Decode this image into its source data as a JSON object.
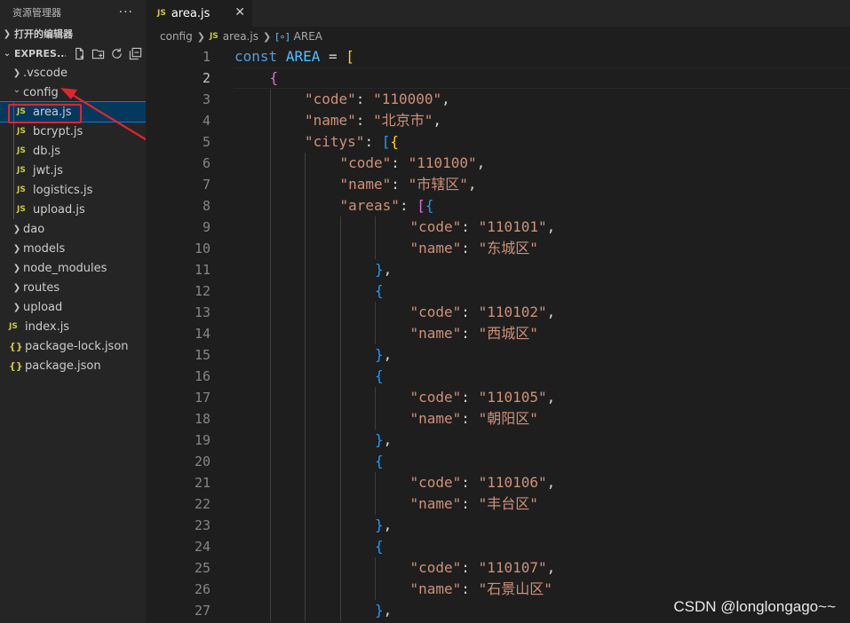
{
  "sidebar": {
    "title": "资源管理器",
    "more": "···",
    "open_editors": "打开的编辑器",
    "project": "EXPRES...",
    "tree": [
      {
        "name": ".vscode",
        "kind": "folder",
        "expanded": false
      },
      {
        "name": "config",
        "kind": "folder",
        "expanded": true
      },
      {
        "name": "area.js",
        "kind": "js",
        "selected": true
      },
      {
        "name": "bcrypt.js",
        "kind": "js"
      },
      {
        "name": "db.js",
        "kind": "js"
      },
      {
        "name": "jwt.js",
        "kind": "js"
      },
      {
        "name": "logistics.js",
        "kind": "js"
      },
      {
        "name": "upload.js",
        "kind": "js"
      },
      {
        "name": "dao",
        "kind": "folder",
        "expanded": false
      },
      {
        "name": "models",
        "kind": "folder",
        "expanded": false
      },
      {
        "name": "node_modules",
        "kind": "folder",
        "expanded": false
      },
      {
        "name": "routes",
        "kind": "folder",
        "expanded": false
      },
      {
        "name": "upload",
        "kind": "folder",
        "expanded": false
      },
      {
        "name": "index.js",
        "kind": "js"
      },
      {
        "name": "package-lock.json",
        "kind": "json"
      },
      {
        "name": "package.json",
        "kind": "json"
      }
    ],
    "js_icon": "JS",
    "json_icon": "{}"
  },
  "editor": {
    "tab_label": "area.js",
    "tab_close": "✕",
    "breadcrumb": {
      "folder": "config",
      "file": "area.js",
      "symbol": "AREA"
    },
    "active_line": 2,
    "lines": [
      {
        "n": "1",
        "indent": 0,
        "tokens": [
          [
            "kw",
            "const"
          ],
          [
            "op",
            " "
          ],
          [
            "cn",
            "AREA"
          ],
          [
            "op",
            " = "
          ],
          [
            "b1",
            "["
          ]
        ]
      },
      {
        "n": "2",
        "indent": 1,
        "tokens": [
          [
            "b2",
            "{"
          ]
        ]
      },
      {
        "n": "3",
        "indent": 2,
        "tokens": [
          [
            "str",
            "\"code\""
          ],
          [
            "op",
            ": "
          ],
          [
            "str",
            "\"110000\""
          ],
          [
            "op",
            ","
          ]
        ]
      },
      {
        "n": "4",
        "indent": 2,
        "tokens": [
          [
            "str",
            "\"name\""
          ],
          [
            "op",
            ": "
          ],
          [
            "str",
            "\"北京市\""
          ],
          [
            "op",
            ","
          ]
        ]
      },
      {
        "n": "5",
        "indent": 2,
        "tokens": [
          [
            "str",
            "\"citys\""
          ],
          [
            "op",
            ": "
          ],
          [
            "b3",
            "["
          ],
          [
            "b1",
            "{"
          ]
        ]
      },
      {
        "n": "6",
        "indent": 3,
        "tokens": [
          [
            "str",
            "\"code\""
          ],
          [
            "op",
            ": "
          ],
          [
            "str",
            "\"110100\""
          ],
          [
            "op",
            ","
          ]
        ]
      },
      {
        "n": "7",
        "indent": 3,
        "tokens": [
          [
            "str",
            "\"name\""
          ],
          [
            "op",
            ": "
          ],
          [
            "str",
            "\"市辖区\""
          ],
          [
            "op",
            ","
          ]
        ]
      },
      {
        "n": "8",
        "indent": 3,
        "tokens": [
          [
            "str",
            "\"areas\""
          ],
          [
            "op",
            ": "
          ],
          [
            "b2",
            "["
          ],
          [
            "b3",
            "{"
          ]
        ]
      },
      {
        "n": "9",
        "indent": 5,
        "tokens": [
          [
            "str",
            "\"code\""
          ],
          [
            "op",
            ": "
          ],
          [
            "str",
            "\"110101\""
          ],
          [
            "op",
            ","
          ]
        ]
      },
      {
        "n": "10",
        "indent": 5,
        "tokens": [
          [
            "str",
            "\"name\""
          ],
          [
            "op",
            ": "
          ],
          [
            "str",
            "\"东城区\""
          ]
        ]
      },
      {
        "n": "11",
        "indent": 4,
        "tokens": [
          [
            "b3",
            "}"
          ],
          [
            "op",
            ","
          ]
        ]
      },
      {
        "n": "12",
        "indent": 4,
        "tokens": [
          [
            "b3",
            "{"
          ]
        ]
      },
      {
        "n": "13",
        "indent": 5,
        "tokens": [
          [
            "str",
            "\"code\""
          ],
          [
            "op",
            ": "
          ],
          [
            "str",
            "\"110102\""
          ],
          [
            "op",
            ","
          ]
        ]
      },
      {
        "n": "14",
        "indent": 5,
        "tokens": [
          [
            "str",
            "\"name\""
          ],
          [
            "op",
            ": "
          ],
          [
            "str",
            "\"西城区\""
          ]
        ]
      },
      {
        "n": "15",
        "indent": 4,
        "tokens": [
          [
            "b3",
            "}"
          ],
          [
            "op",
            ","
          ]
        ]
      },
      {
        "n": "16",
        "indent": 4,
        "tokens": [
          [
            "b3",
            "{"
          ]
        ]
      },
      {
        "n": "17",
        "indent": 5,
        "tokens": [
          [
            "str",
            "\"code\""
          ],
          [
            "op",
            ": "
          ],
          [
            "str",
            "\"110105\""
          ],
          [
            "op",
            ","
          ]
        ]
      },
      {
        "n": "18",
        "indent": 5,
        "tokens": [
          [
            "str",
            "\"name\""
          ],
          [
            "op",
            ": "
          ],
          [
            "str",
            "\"朝阳区\""
          ]
        ]
      },
      {
        "n": "19",
        "indent": 4,
        "tokens": [
          [
            "b3",
            "}"
          ],
          [
            "op",
            ","
          ]
        ]
      },
      {
        "n": "20",
        "indent": 4,
        "tokens": [
          [
            "b3",
            "{"
          ]
        ]
      },
      {
        "n": "21",
        "indent": 5,
        "tokens": [
          [
            "str",
            "\"code\""
          ],
          [
            "op",
            ": "
          ],
          [
            "str",
            "\"110106\""
          ],
          [
            "op",
            ","
          ]
        ]
      },
      {
        "n": "22",
        "indent": 5,
        "tokens": [
          [
            "str",
            "\"name\""
          ],
          [
            "op",
            ": "
          ],
          [
            "str",
            "\"丰台区\""
          ]
        ]
      },
      {
        "n": "23",
        "indent": 4,
        "tokens": [
          [
            "b3",
            "}"
          ],
          [
            "op",
            ","
          ]
        ]
      },
      {
        "n": "24",
        "indent": 4,
        "tokens": [
          [
            "b3",
            "{"
          ]
        ]
      },
      {
        "n": "25",
        "indent": 5,
        "tokens": [
          [
            "str",
            "\"code\""
          ],
          [
            "op",
            ": "
          ],
          [
            "str",
            "\"110107\""
          ],
          [
            "op",
            ","
          ]
        ]
      },
      {
        "n": "26",
        "indent": 5,
        "tokens": [
          [
            "str",
            "\"name\""
          ],
          [
            "op",
            ": "
          ],
          [
            "str",
            "\"石景山区\""
          ]
        ]
      },
      {
        "n": "27",
        "indent": 4,
        "tokens": [
          [
            "b3",
            "}"
          ],
          [
            "op",
            ","
          ]
        ]
      }
    ]
  },
  "colors": {
    "annotation_red": "#e0262c",
    "selection_bg": "#04395e",
    "js_icon": "#cbcb41"
  },
  "watermark": "CSDN @longlongago~~"
}
